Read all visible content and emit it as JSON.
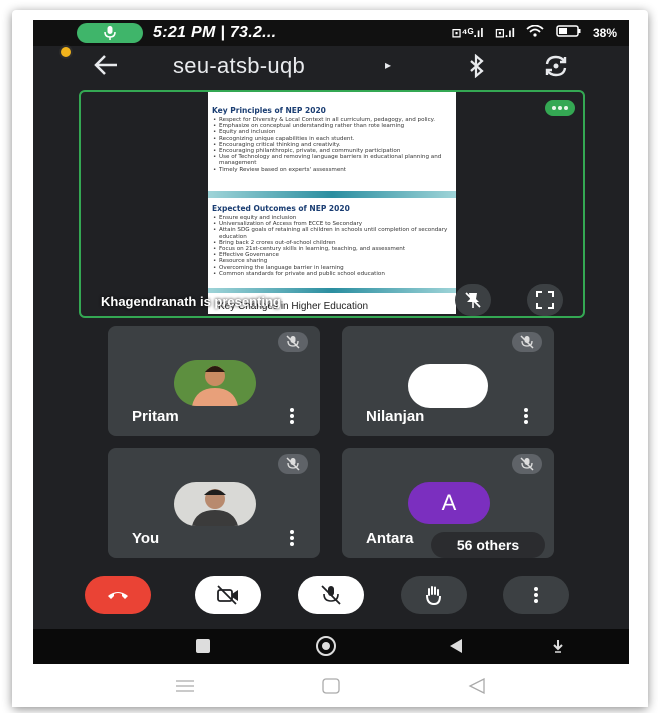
{
  "status_bar": {
    "time": "5:21 PM | 73.2...",
    "icons": [
      "volte-icon",
      "signal-icon",
      "wifi-icon",
      "battery-icon"
    ],
    "battery": "38%"
  },
  "meeting": {
    "code": "seu-atsb-uqb",
    "caret": "▸"
  },
  "presentation": {
    "presenter_text": "Khagendranath is presenting",
    "slide": {
      "section1_title": "Key Principles of NEP 2020",
      "section1_items": [
        "Respect for Diversity & Local Context in all curriculum, pedagogy, and policy.",
        "Emphasize on conceptual understanding rather than rote learning",
        "Equity and inclusion",
        "Recognizing unique capabilities in each student.",
        "Encouraging critical thinking and creativity.",
        "Encouraging philanthropic, private, and community participation",
        "Use of Technology and removing language barriers in educational planning and management",
        "Timely Review based on experts' assessment"
      ],
      "section2_title": "Expected Outcomes of NEP 2020",
      "section2_items": [
        "Ensure equity and inclusion",
        "Universalization of Access from ECCE to Secondary",
        "Attain SDG goals of retaining all children in schools until completion of secondary education",
        "Bring back 2 crores out-of-school children",
        "Focus on 21st-century skills in learning, teaching, and assessment",
        "Effective Governance",
        "Resource sharing",
        "Overcoming the language barrier in learning",
        "Common standards for private and public school education"
      ],
      "bottom_text": "Key Changes in Higher Education"
    }
  },
  "participants": [
    {
      "name": "Pritam",
      "muted": true
    },
    {
      "name": "Nilanjan",
      "muted": true
    },
    {
      "name": "You",
      "muted": true
    },
    {
      "name": "Antara",
      "muted": true,
      "initial": "A",
      "avatar_color": "#7b2fbf"
    }
  ],
  "others_label": "56 others",
  "controls": {
    "end_call_color": "#ea4335",
    "camera": "camera-off",
    "mic": "mic-off",
    "raise_hand": "hand",
    "more": "more"
  },
  "colors": {
    "presenting_border": "#34a853",
    "tile_bg": "#3c4043",
    "screen_bg": "#202124"
  }
}
